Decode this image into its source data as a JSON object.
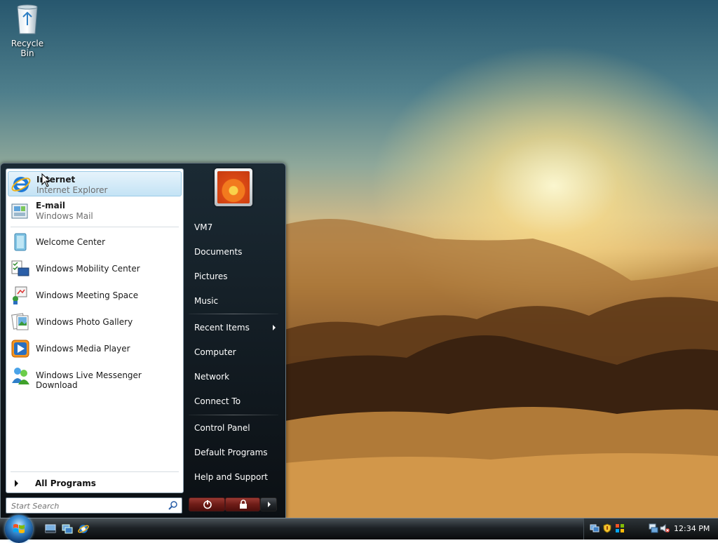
{
  "desktop": {
    "icons": [
      {
        "label": "Recycle Bin",
        "icon": "recycle-bin-icon"
      }
    ]
  },
  "start_menu": {
    "pinned": [
      {
        "title": "Internet",
        "subtitle": "Internet Explorer",
        "icon": "internet-explorer-icon",
        "highlighted": true
      },
      {
        "title": "E-mail",
        "subtitle": "Windows Mail",
        "icon": "windows-mail-icon"
      }
    ],
    "recent": [
      {
        "title": "Welcome Center",
        "icon": "welcome-center-icon"
      },
      {
        "title": "Windows Mobility Center",
        "icon": "mobility-center-icon"
      },
      {
        "title": "Windows Meeting Space",
        "icon": "meeting-space-icon"
      },
      {
        "title": "Windows Photo Gallery",
        "icon": "photo-gallery-icon"
      },
      {
        "title": "Windows Media Player",
        "icon": "media-player-icon"
      },
      {
        "title": "Windows Live Messenger Download",
        "icon": "messenger-icon"
      }
    ],
    "all_programs_label": "All Programs",
    "search_placeholder": "Start Search",
    "right_pane": {
      "user_name": "VM7",
      "group1": [
        "Documents",
        "Pictures",
        "Music"
      ],
      "group2": [
        "Recent Items",
        "Computer",
        "Network",
        "Connect To"
      ],
      "group3": [
        "Control Panel",
        "Default Programs",
        "Help and Support"
      ]
    }
  },
  "taskbar": {
    "quick_launch": [
      "show-desktop-icon",
      "switch-windows-icon",
      "internet-explorer-icon"
    ],
    "tray_icons": [
      "network-status-icon",
      "security-alert-icon",
      "windows-update-icon",
      "network-connection-icon",
      "volume-muted-icon"
    ],
    "clock": "12:34 PM"
  },
  "colors": {
    "highlight": "#c4e3f5",
    "taskbar": "#1d2226",
    "power_button": "#6e1c17"
  }
}
